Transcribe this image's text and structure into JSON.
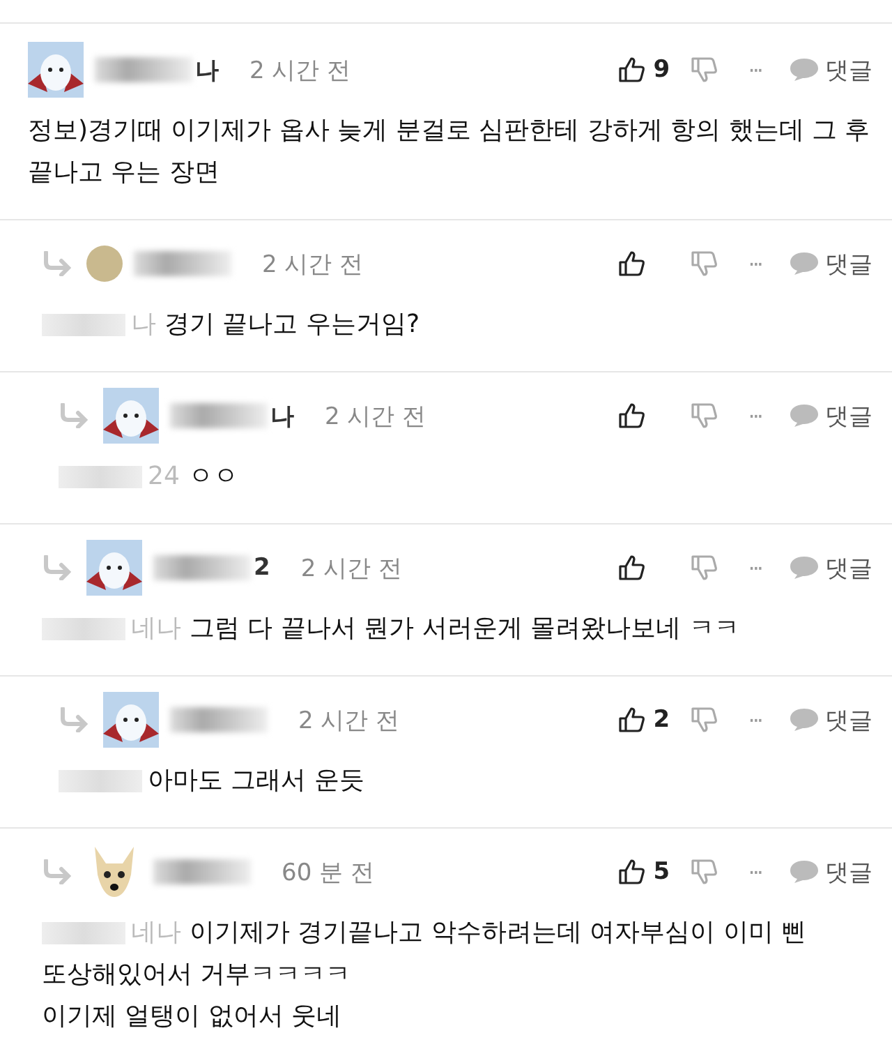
{
  "comments": [
    {
      "kind": "bear",
      "author": "나",
      "time": "2 시간 전",
      "likes": "9",
      "body": "정보)경기때 이기제가 옵사 늦게 분걸로 심판한테 강하게 항의 했는데 그 후 끝나고 우는 장면",
      "dots": "···",
      "reply": "댓글",
      "replies": [
        {
          "kind": "circle",
          "time": "2 시간 전",
          "mention": "나",
          "body": "경기 끝나고 우는거임?",
          "dots": "···",
          "reply": "댓글",
          "replies": [
            {
              "kind": "bear",
              "author": "나",
              "time": "2 시간 전",
              "mention": "24",
              "body": "ㅇㅇ",
              "dots": "···",
              "reply": "댓글"
            }
          ]
        },
        {
          "kind": "bear",
          "author": "2",
          "time": "2 시간 전",
          "mention": "네나",
          "body": "그럼 다 끝나서 뭔가 서러운게 몰려왔나보네 ㅋㅋ",
          "dots": "···",
          "reply": "댓글",
          "replies": [
            {
              "kind": "bear",
              "time": "2 시간 전",
              "likes": "2",
              "body": "아마도 그래서 운듯",
              "dots": "···",
              "reply": "댓글"
            }
          ]
        },
        {
          "kind": "dog",
          "time": "60 분 전",
          "likes": "5",
          "mention": "네나",
          "body": "이기제가 경기끝나고 악수하려는데 여자부심이 이미 삔\n또상해있어서 거부ㅋㅋㅋㅋ\n이기제 얼탱이 없어서 웃네",
          "dots": "···",
          "reply": "댓글"
        }
      ]
    }
  ]
}
